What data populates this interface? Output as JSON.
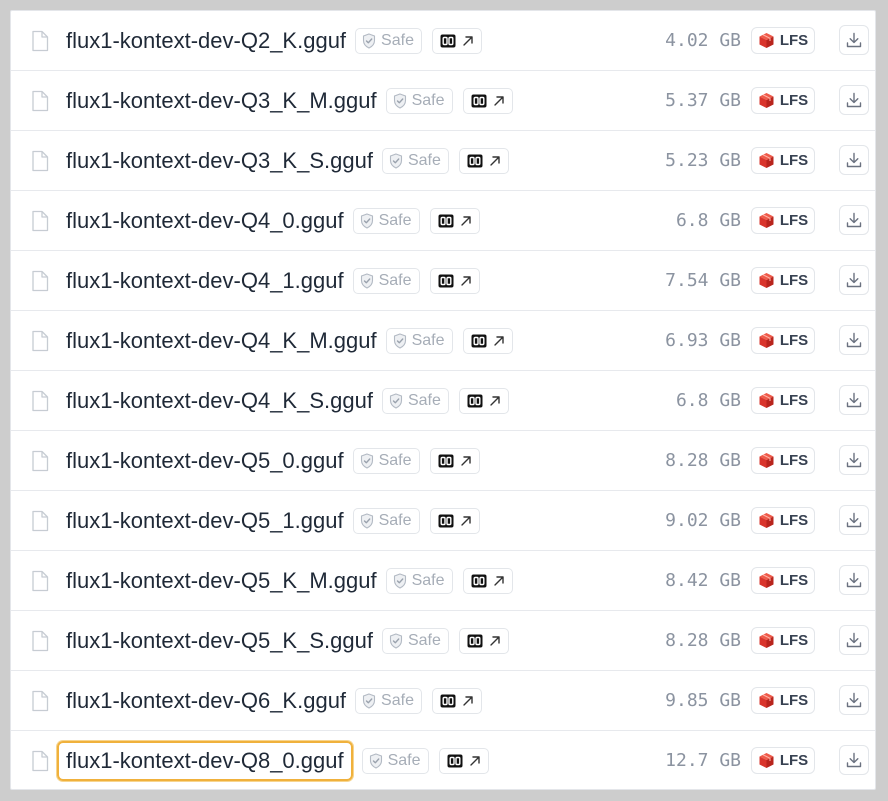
{
  "files": [
    {
      "name": "flux1-kontext-dev-Q2_K.gguf",
      "safe_label": "Safe",
      "size": "4.02 GB",
      "lfs_label": "LFS",
      "highlighted": false
    },
    {
      "name": "flux1-kontext-dev-Q3_K_M.gguf",
      "safe_label": "Safe",
      "size": "5.37 GB",
      "lfs_label": "LFS",
      "highlighted": false
    },
    {
      "name": "flux1-kontext-dev-Q3_K_S.gguf",
      "safe_label": "Safe",
      "size": "5.23 GB",
      "lfs_label": "LFS",
      "highlighted": false
    },
    {
      "name": "flux1-kontext-dev-Q4_0.gguf",
      "safe_label": "Safe",
      "size": "6.8 GB",
      "lfs_label": "LFS",
      "highlighted": false
    },
    {
      "name": "flux1-kontext-dev-Q4_1.gguf",
      "safe_label": "Safe",
      "size": "7.54 GB",
      "lfs_label": "LFS",
      "highlighted": false
    },
    {
      "name": "flux1-kontext-dev-Q4_K_M.gguf",
      "safe_label": "Safe",
      "size": "6.93 GB",
      "lfs_label": "LFS",
      "highlighted": false
    },
    {
      "name": "flux1-kontext-dev-Q4_K_S.gguf",
      "safe_label": "Safe",
      "size": "6.8 GB",
      "lfs_label": "LFS",
      "highlighted": false
    },
    {
      "name": "flux1-kontext-dev-Q5_0.gguf",
      "safe_label": "Safe",
      "size": "8.28 GB",
      "lfs_label": "LFS",
      "highlighted": false
    },
    {
      "name": "flux1-kontext-dev-Q5_1.gguf",
      "safe_label": "Safe",
      "size": "9.02 GB",
      "lfs_label": "LFS",
      "highlighted": false
    },
    {
      "name": "flux1-kontext-dev-Q5_K_M.gguf",
      "safe_label": "Safe",
      "size": "8.42 GB",
      "lfs_label": "LFS",
      "highlighted": false
    },
    {
      "name": "flux1-kontext-dev-Q5_K_S.gguf",
      "safe_label": "Safe",
      "size": "8.28 GB",
      "lfs_label": "LFS",
      "highlighted": false
    },
    {
      "name": "flux1-kontext-dev-Q6_K.gguf",
      "safe_label": "Safe",
      "size": "9.85 GB",
      "lfs_label": "LFS",
      "highlighted": false
    },
    {
      "name": "flux1-kontext-dev-Q8_0.gguf",
      "safe_label": "Safe",
      "size": "12.7 GB",
      "lfs_label": "LFS",
      "highlighted": true
    }
  ],
  "icons": {
    "file": "file-icon",
    "safe": "shield-check-icon",
    "viewer": "gguf-viewer-icon",
    "external": "arrow-up-right-icon",
    "lfs": "lfs-cube-icon",
    "download": "download-icon"
  },
  "colors": {
    "highlight": "#f0b13c",
    "lfs_red": "#d9352c"
  }
}
